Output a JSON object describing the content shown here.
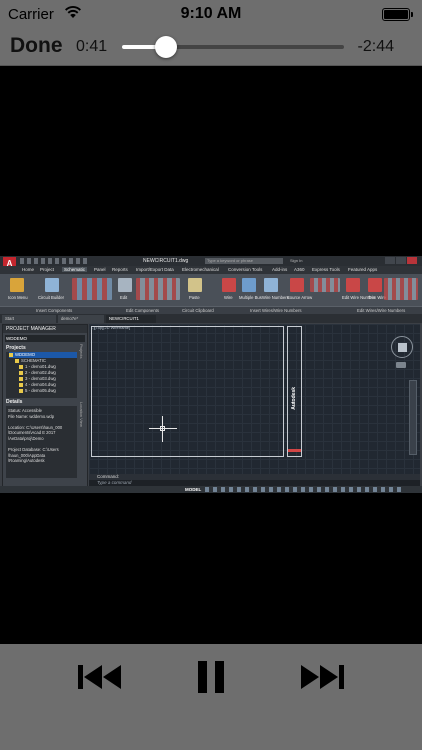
{
  "status_bar": {
    "carrier": "Carrier",
    "time": "9:10 AM"
  },
  "player": {
    "done_label": "Done",
    "elapsed": "0:41",
    "remaining": "-2:44",
    "progress_fraction": 0.2
  },
  "video": {
    "app_logo": "A",
    "document_title": "NEWCIRCUIT1.dwg",
    "search_placeholder": "Type a keyword or phrase",
    "sign_in": "Sign In",
    "ribbon_tabs": [
      "Home",
      "Project",
      "Schematic",
      "Panel",
      "Reports",
      "Import/Export Data",
      "Electromechanical",
      "Conversion Tools",
      "Add-ins",
      "A360",
      "Express Tools",
      "Featured Apps"
    ],
    "active_ribbon_tab": "Schematic",
    "ribbon_buttons": [
      "Icon Menu",
      "Circuit Builder",
      "Edit",
      "Paste",
      "Wire",
      "Multiple Bus",
      "Wire Numbers",
      "Source Arrow",
      "Edit Wire Number",
      "Trim Wire"
    ],
    "ribbon_panels": [
      "Insert Components",
      "Edit Components",
      "Circuit Clipboard",
      "Insert Wires/Wire Numbers",
      "Edit Wires/Wire Numbers"
    ],
    "doc_tabs": [
      "Start",
      "demo7e*",
      "NEWCIRCUIT1"
    ],
    "active_doc_tab": "NEWCIRCUIT1",
    "project_manager": {
      "title": "PROJECT MANAGER",
      "selected_project": "WDDEMO",
      "projects_label": "Projects",
      "tree": [
        "WDDEMO",
        "SCHEMATIC",
        "1 - demo01.dwg",
        "2 - demo02.dwg",
        "3 - demo03.dwg",
        "4 - demo04.dwg",
        "5 - demo05.dwg"
      ],
      "details_label": "Details",
      "details_lines": [
        "Status: Accessible",
        "File Name: wddemo.wdp",
        "",
        "Location: C:\\Users\\haun_000",
        "\\Documents\\Acad E 2017",
        "\\AeData\\proj\\Demo",
        "",
        "Project Database: C:\\Users",
        "\\haun_000\\AppData",
        "\\Roaming\\Autodesk"
      ]
    },
    "side_tabs": [
      "Projects",
      "Location View"
    ],
    "viewport_label": "[-][Top][2D Wireframe]",
    "title_block_text": "Autodesk",
    "command_label": "Command:",
    "command_placeholder": "Type a command",
    "model_label": "MODEL"
  }
}
